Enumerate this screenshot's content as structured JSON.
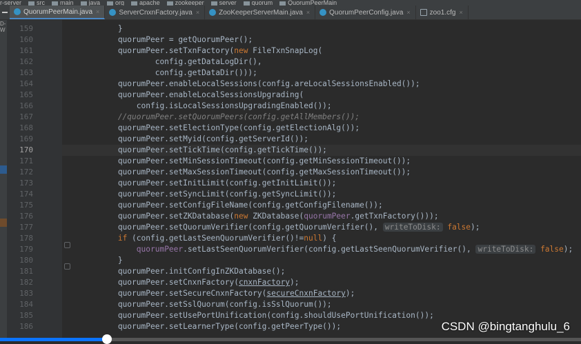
{
  "breadcrumb": [
    "r-server",
    "src",
    "main",
    "java",
    "org",
    "apache",
    "zookeeper",
    "server",
    "quorum",
    "QuorumPeerMain"
  ],
  "tabs": [
    {
      "label": "QuorumPeerMain.java",
      "active": true,
      "icon": "java-class-icon"
    },
    {
      "label": "ServerCnxnFactory.java",
      "active": false,
      "icon": "java-class-icon"
    },
    {
      "label": "ZooKeeperServerMain.java",
      "active": false,
      "icon": "java-class-icon"
    },
    {
      "label": "QuorumPeerConfig.java",
      "active": false,
      "icon": "java-class-icon"
    },
    {
      "label": "zoo1.cfg",
      "active": false,
      "icon": "config-file-icon"
    }
  ],
  "tab_close_glyph": "×",
  "side_label": "D-W",
  "editor": {
    "first_line": 159,
    "current_line": 170,
    "lines": [
      {
        "n": 159,
        "tokens": [
          {
            "t": "            }"
          }
        ]
      },
      {
        "n": 160,
        "tokens": [
          {
            "t": "            quorumPeer = getQuorumPeer();"
          }
        ]
      },
      {
        "n": 161,
        "tokens": [
          {
            "t": "            quorumPeer.setTxnFactory("
          },
          {
            "t": "new",
            "c": "kw"
          },
          {
            "t": " FileTxnSnapLog("
          }
        ]
      },
      {
        "n": 162,
        "tokens": [
          {
            "t": "                    config.getDataLogDir(),"
          }
        ]
      },
      {
        "n": 163,
        "tokens": [
          {
            "t": "                    config.getDataDir()));"
          }
        ]
      },
      {
        "n": 164,
        "tokens": [
          {
            "t": "            quorumPeer.enableLocalSessions(config.areLocalSessionsEnabled());"
          }
        ]
      },
      {
        "n": 165,
        "tokens": [
          {
            "t": "            quorumPeer.enableLocalSessionsUpgrading("
          }
        ]
      },
      {
        "n": 166,
        "tokens": [
          {
            "t": "                config.isLocalSessionsUpgradingEnabled());"
          }
        ]
      },
      {
        "n": 167,
        "tokens": [
          {
            "t": "            //quorumPeer.setQuorumPeers(config.getAllMembers());",
            "c": "cm"
          }
        ]
      },
      {
        "n": 168,
        "tokens": [
          {
            "t": "            quorumPeer.setElectionType(config.getElectionAlg());"
          }
        ]
      },
      {
        "n": 169,
        "tokens": [
          {
            "t": "            quorumPeer.setMyid(config.getServerId());"
          }
        ]
      },
      {
        "n": 170,
        "tokens": [
          {
            "t": "            quorumPeer.setTickTime(config.getTickTime());"
          }
        ]
      },
      {
        "n": 171,
        "tokens": [
          {
            "t": "            quorumPeer.setMinSessionTimeout(config.getMinSessionTimeout());"
          }
        ]
      },
      {
        "n": 172,
        "tokens": [
          {
            "t": "            quorumPeer.setMaxSessionTimeout(config.getMaxSessionTimeout());"
          }
        ]
      },
      {
        "n": 173,
        "tokens": [
          {
            "t": "            quorumPeer.setInitLimit(config.getInitLimit());"
          }
        ]
      },
      {
        "n": 174,
        "tokens": [
          {
            "t": "            quorumPeer.setSyncLimit(config.getSyncLimit());"
          }
        ]
      },
      {
        "n": 175,
        "tokens": [
          {
            "t": "            quorumPeer.setConfigFileName(config.getConfigFilename());"
          }
        ]
      },
      {
        "n": 176,
        "tokens": [
          {
            "t": "            quorumPeer.setZKDatabase("
          },
          {
            "t": "new",
            "c": "kw"
          },
          {
            "t": " ZKDatabase("
          },
          {
            "t": "quorumPeer",
            "c": "fld"
          },
          {
            "t": ".getTxnFactory()));"
          }
        ]
      },
      {
        "n": 177,
        "tokens": [
          {
            "t": "            quorumPeer.setQuorumVerifier(config.getQuorumVerifier(), "
          },
          {
            "t": "writeToDisk:",
            "c": "hint"
          },
          {
            "t": " "
          },
          {
            "t": "false",
            "c": "kw"
          },
          {
            "t": ");"
          }
        ]
      },
      {
        "n": 178,
        "tokens": [
          {
            "t": "            "
          },
          {
            "t": "if",
            "c": "kw"
          },
          {
            "t": " (config.getLastSeenQuorumVerifier()!="
          },
          {
            "t": "null",
            "c": "kw"
          },
          {
            "t": ") {"
          }
        ]
      },
      {
        "n": 179,
        "tokens": [
          {
            "t": "                "
          },
          {
            "t": "quorumPeer",
            "c": "fld"
          },
          {
            "t": ".setLastSeenQuorumVerifier(config.getLastSeenQuorumVerifier(), "
          },
          {
            "t": "writeToDisk:",
            "c": "hint"
          },
          {
            "t": " "
          },
          {
            "t": "false",
            "c": "kw"
          },
          {
            "t": ");"
          }
        ]
      },
      {
        "n": 180,
        "tokens": [
          {
            "t": "            }"
          }
        ]
      },
      {
        "n": 181,
        "tokens": [
          {
            "t": "            quorumPeer.initConfigInZKDatabase();"
          }
        ]
      },
      {
        "n": 182,
        "tokens": [
          {
            "t": "            quorumPeer.setCnxnFactory("
          },
          {
            "t": "cnxnFactory",
            "c": "ul"
          },
          {
            "t": ");"
          }
        ]
      },
      {
        "n": 183,
        "tokens": [
          {
            "t": "            quorumPeer.setSecureCnxnFactory("
          },
          {
            "t": "secureCnxnFactory",
            "c": "ul"
          },
          {
            "t": ");"
          }
        ]
      },
      {
        "n": 184,
        "tokens": [
          {
            "t": "            quorumPeer.setSslQuorum(config.isSslQuorum());"
          }
        ]
      },
      {
        "n": 185,
        "tokens": [
          {
            "t": "            quorumPeer.setUsePortUnification(config.shouldUsePortUnification());"
          }
        ]
      },
      {
        "n": 186,
        "tokens": [
          {
            "t": "            quorumPeer.setLearnerType(config.getPeerType());"
          }
        ]
      }
    ]
  },
  "watermark": "CSDN @bingtanghulu_6",
  "video_progress": 0.184,
  "colors": {
    "keyword": "#cc7832",
    "field": "#9876aa",
    "comment": "#808080",
    "text": "#a9b7c6",
    "progress": "#0b74ff"
  }
}
